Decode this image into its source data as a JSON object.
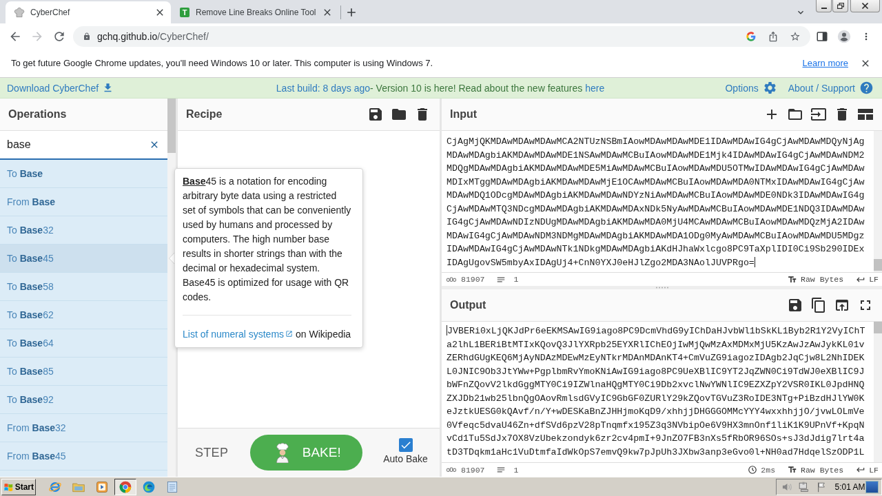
{
  "browser": {
    "tabs": [
      {
        "title": "CyberChef",
        "favicon": {
          "kind": "hat"
        },
        "selected": true
      },
      {
        "title": "Remove Line Breaks Online Tool",
        "favicon": {
          "kind": "letter",
          "text": "T"
        },
        "selected": false
      }
    ],
    "nav": {
      "forward_disabled": true
    },
    "address": {
      "host": "gchq.github.io",
      "path": "/CyberChef/"
    },
    "infobar": {
      "message": "To get future Google Chrome updates, you'll need Windows 10 or later. This computer is using Windows 7.",
      "link": "Learn more"
    }
  },
  "banner": {
    "download": "Download CyberChef",
    "build": "Last build: 8 days ago",
    "notice": "- Version 10 is here! Read about the new features",
    "notice_link": "here",
    "options": "Options",
    "about": "About / Support"
  },
  "operations": {
    "title": "Operations",
    "search": {
      "value": "base"
    },
    "items": [
      {
        "label": "To **Base**",
        "hovered": false
      },
      {
        "label": "From **Base**",
        "hovered": false
      },
      {
        "label": "To **Base**32",
        "hovered": false
      },
      {
        "label": "To **Base**45",
        "hovered": true
      },
      {
        "label": "To **Base**58",
        "hovered": false
      },
      {
        "label": "To **Base**62",
        "hovered": false
      },
      {
        "label": "To **Base**64",
        "hovered": false
      },
      {
        "label": "To **Base**85",
        "hovered": false
      },
      {
        "label": "To **Base**92",
        "hovered": false
      },
      {
        "label": "From **Base**32",
        "hovered": false
      },
      {
        "label": "From **Base**45",
        "hovered": false
      }
    ]
  },
  "tooltip": {
    "paragraphs": [
      "**Base**45 is a notation for encoding arbitrary byte data using a restricted set of symbols that can be conveniently used by humans and processed by computers. The high number base results in shorter strings than with the decimal or hexadecimal system.",
      "Base45 is optimized for usage with QR codes."
    ],
    "link": "List of numeral systems",
    "link_suffix": "on Wikipedia"
  },
  "recipe": {
    "title": "Recipe",
    "step": "STEP",
    "bake": "BAKE!",
    "auto_bake": {
      "label": "Auto Bake",
      "checked": true
    }
  },
  "input": {
    "title": "Input",
    "lines": [
      "CjAgMjQKMDAwMDAwMDAwMCA2NTUzNSBmIAowMDAwMDAwMDE1IDAwMDAwIG4gCjAwMDAwMDQyNjAg",
      "MDAwMDAgbiAKMDAwMDAwMDE1NSAwMDAwMCBuIAowMDAwMDE1Mjk4IDAwMDAwIG4gCjAwMDAwNDM2",
      "MDQgMDAwMDAgbiAKMDAwMDAwMDE5MiAwMDAwMCBuIAowMDAwMDU5OTMwIDAwMDAwIG4gCjAwMDAw",
      "MDIxMTggMDAwMDAgbiAKMDAwMDAwMjE1OCAwMDAwMCBuIAowMDAwMDA0NTMxIDAwMDAwIG4gCjAw",
      "MDAwMDQ1ODcgMDAwMDAgbiAKMDAwMDAwNDYzNiAwMDAwMCBuIAowMDAwMDE0NDk3IDAwMDAwIG4g",
      "CjAwMDAwMTQ3NDcgMDAwMDAgbiAKMDAwMDAxNDk5NyAwMDAwMCBuIAowMDAwMDE1NDQ3IDAwMDAw",
      "IG4gCjAwMDAwNDIzNDUgMDAwMDAgbiAKMDAwMDA0MjU4MCAwMDAwMCBuIAowMDAwMDQzMjA2IDAw",
      "MDAwIG4gCjAwMDAwNDM3NDMgMDAwMDAgbiAKMDAwMDA1ODg0MyAwMDAwMCBuIAowMDAwMDU5MDgz",
      "IDAwMDAwIG4gCjAwMDAwNTk1NDkgMDAwMDAgbiAKdHJhaWxlcgo8PC9TaXplIDI0Ci9Sb290IDEx",
      "IDAgUgovSW5mbyAxIDAgUj4+CnN0YXJ0eHJlZgo2MDA3NAolJUVPRgo="
    ],
    "length": "81907",
    "line_count": "1",
    "format": "Raw Bytes",
    "eol": "LF"
  },
  "output": {
    "title": "Output",
    "lines": [
      "JVBERi0xLjQKJdPr6eEKMSAwIG9iago8PC9DcmVhdG9yIChDaHJvbWl1bSkKL1Byb2R1Y2VyIChT",
      "a2lhL1BERiBtMTIxKQovQ3JlYXRpb25EYXRlIChEOjIwMjQwMzAxMDMxMjU5KzAwJzAwJykKL01v",
      "ZERhdGUgKEQ6MjAyNDAzMDEwMzEyNTkrMDAnMDAnKT4+CmVuZG9iagozIDAgb2JqCjw8L2NhIDEK",
      "L0JNIC9Ob3JtYWw+PgplbmRvYmoKNiAwIG9iago8PC9UeXBlIC9YT2JqZWN0Ci9TdWJ0eXBlIC9J",
      "bWFnZQovV2lkdGggMTY0Ci9IZWlnaHQgMTY0Ci9Db2xvclNwYWNlIC9EZXZpY2VSR0IKL0JpdHNQ",
      "ZXJDb21wb25lbnQgOAovRmlsdGVyIC9GbGF0ZURlY29kZQovTGVuZ3RoIDE3NTg+PiBzdHJlYW0K",
      "eJztkUESG0kQAvf/n/Y+wDESKaBnZJHHjmoKqD9/xhhjjDHGGGOMMcYYY4wxxhhjjO/jvwLOLmVe",
      "0Vfeqc5dvaU46Zn+dfSVd6pzV28pTnqmfx195Z3q3NVbipOe6V9HX3mnOnf1liK1K9UPnVf+KpqN",
      "vCd1Tu5SdJx7OX8VzUbekzondyk6zr2cv4pmI+9JnZO7FB3nXs5fRbOR96SOs+sJ3dJdig7lrt4a",
      "tD3TDqkm1aHc1VuDtmfaIdWkOpS7emvQ9kw7pJpUh3JXbw3anp3eGvo0l+NH0ad7HdqelSzODP1L"
    ],
    "length": "81907",
    "line_count": "1",
    "time": "2ms",
    "format": "Raw Bytes",
    "eol": "LF"
  },
  "taskbar": {
    "start": "Start",
    "apps": [
      {
        "kind": "ie",
        "selected": false
      },
      {
        "kind": "explorer",
        "selected": false
      },
      {
        "kind": "media",
        "selected": false
      },
      {
        "kind": "chrome",
        "selected": true
      },
      {
        "kind": "edge",
        "selected": false
      },
      {
        "kind": "notepad",
        "selected": false
      }
    ],
    "clock": "5:01 AM"
  }
}
